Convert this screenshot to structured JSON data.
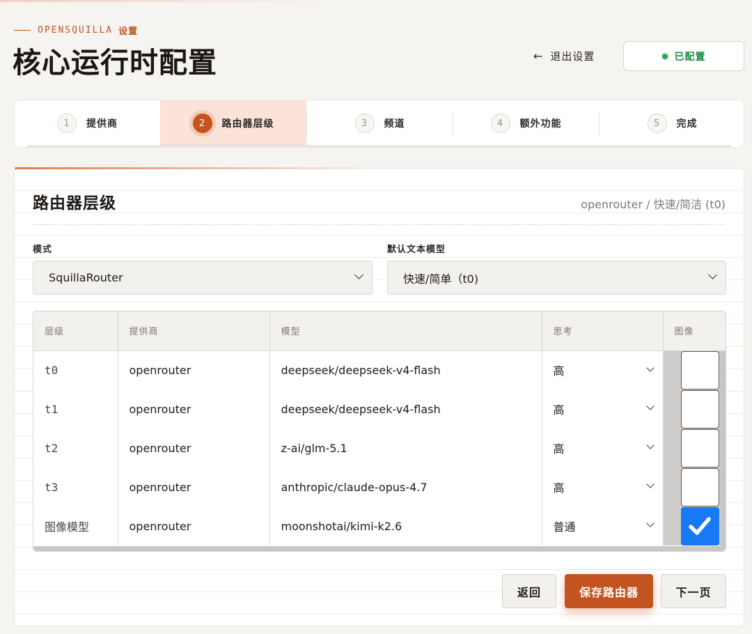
{
  "header": {
    "brand": "OPENSQUILLA",
    "section": "设置",
    "title": "核心运行时配置",
    "exit_label": "退出设置",
    "status_label": "已配置"
  },
  "colors": {
    "accent": "#c4541f",
    "success": "#2fa35b",
    "checkbox": "#1779f3"
  },
  "stepper": {
    "steps": [
      {
        "num": "1",
        "label": "提供商"
      },
      {
        "num": "2",
        "label": "路由器层级"
      },
      {
        "num": "3",
        "label": "频道"
      },
      {
        "num": "4",
        "label": "额外功能"
      },
      {
        "num": "5",
        "label": "完成"
      }
    ],
    "active_step": "2"
  },
  "card": {
    "title": "路由器层级",
    "crumb": "openrouter / 快速/简洁 (t0)",
    "mode_label": "模式",
    "mode_value": "SquillaRouter",
    "default_model_label": "默认文本模型",
    "default_model_value": "快速/简单（t0)"
  },
  "table": {
    "headers": [
      "层级",
      "提供商",
      "模型",
      "思考",
      "图像"
    ],
    "rows": [
      {
        "tier": "t0",
        "provider": "openrouter",
        "model": "deepseek/deepseek-v4-flash",
        "thinking": "高",
        "image": false
      },
      {
        "tier": "t1",
        "provider": "openrouter",
        "model": "deepseek/deepseek-v4-flash",
        "thinking": "高",
        "image": false
      },
      {
        "tier": "t2",
        "provider": "openrouter",
        "model": "z-ai/glm-5.1",
        "thinking": "高",
        "image": false
      },
      {
        "tier": "t3",
        "provider": "openrouter",
        "model": "anthropic/claude-opus-4.7",
        "thinking": "高",
        "image": false
      },
      {
        "tier": "图像模型",
        "provider": "openrouter",
        "model": "moonshotai/kimi-k2.6",
        "thinking": "普通",
        "image": true
      }
    ]
  },
  "actions": {
    "back": "返回",
    "save": "保存路由器",
    "next": "下一页"
  }
}
